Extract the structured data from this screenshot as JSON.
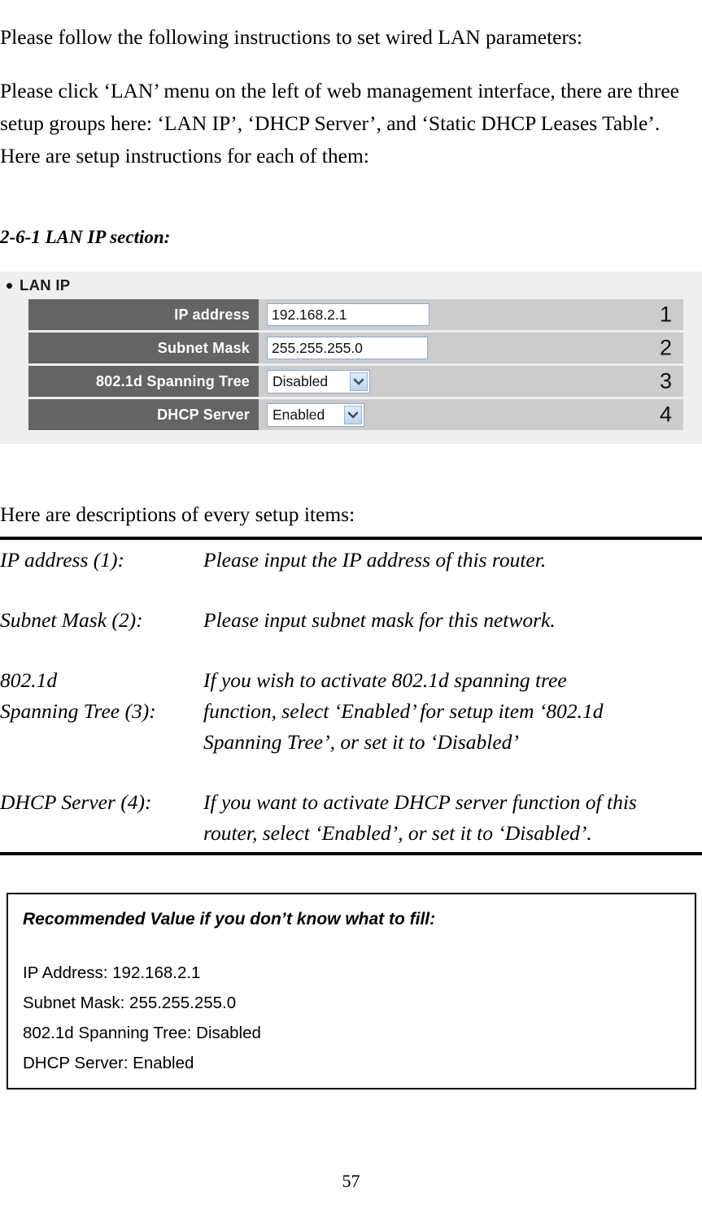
{
  "document": {
    "intro_paragraph_1": "Please follow the following instructions to set wired LAN parameters:",
    "intro_paragraph_2": "Please click ‘LAN’ menu on the left of web management interface, there are three setup groups here: ‘LAN IP’, ‘DHCP Server’, and ‘Static DHCP Leases Table’. Here are setup instructions for each of them:",
    "section_heading": "2-6-1 LAN IP section:",
    "descriptions_lead": "Here are descriptions of every setup items:",
    "page_number": "57"
  },
  "ui_panel": {
    "group_label": "LAN IP",
    "bullet_icon": "bullet-dot-icon",
    "rows": [
      {
        "label": "IP address",
        "control": "textbox",
        "value": "192.168.2.1",
        "marker": "1"
      },
      {
        "label": "Subnet Mask",
        "control": "textbox",
        "value": "255.255.255.0",
        "marker": "2"
      },
      {
        "label": "802.1d Spanning Tree",
        "control": "select",
        "value": "Disabled",
        "marker": "3"
      },
      {
        "label": "DHCP Server",
        "control": "select",
        "value": "Enabled",
        "marker": "4"
      }
    ],
    "select_arrow_icon": "chevron-down-icon",
    "colors": {
      "panel_background": "#efefef",
      "label_cell": "#646464",
      "value_cell": "#cccccc",
      "input_border": "#8ea9c6",
      "select_button": "#bcd4ef"
    }
  },
  "descriptions": [
    {
      "term": "IP address (1):",
      "definition": "Please input the IP address of this router."
    },
    {
      "term": "Subnet Mask (2):",
      "definition": "Please input subnet mask for this network."
    },
    {
      "term": "802.1d\nSpanning Tree (3):",
      "definition": "If you wish to activate 802.1d spanning tree\nfunction, select ‘Enabled’ for setup item ‘802.1d\nSpanning Tree’, or set it to ‘Disabled’"
    },
    {
      "term": "DHCP Server (4):",
      "definition": "If you want to activate DHCP server function of this\nrouter, select ‘Enabled’, or set it to ‘Disabled’."
    }
  ],
  "recommended_box": {
    "heading": "Recommended Value if you don’t know what to fill:",
    "lines": [
      "IP Address: 192.168.2.1",
      "Subnet Mask: 255.255.255.0",
      "802.1d Spanning Tree: Disabled",
      "DHCP Server: Enabled"
    ]
  }
}
